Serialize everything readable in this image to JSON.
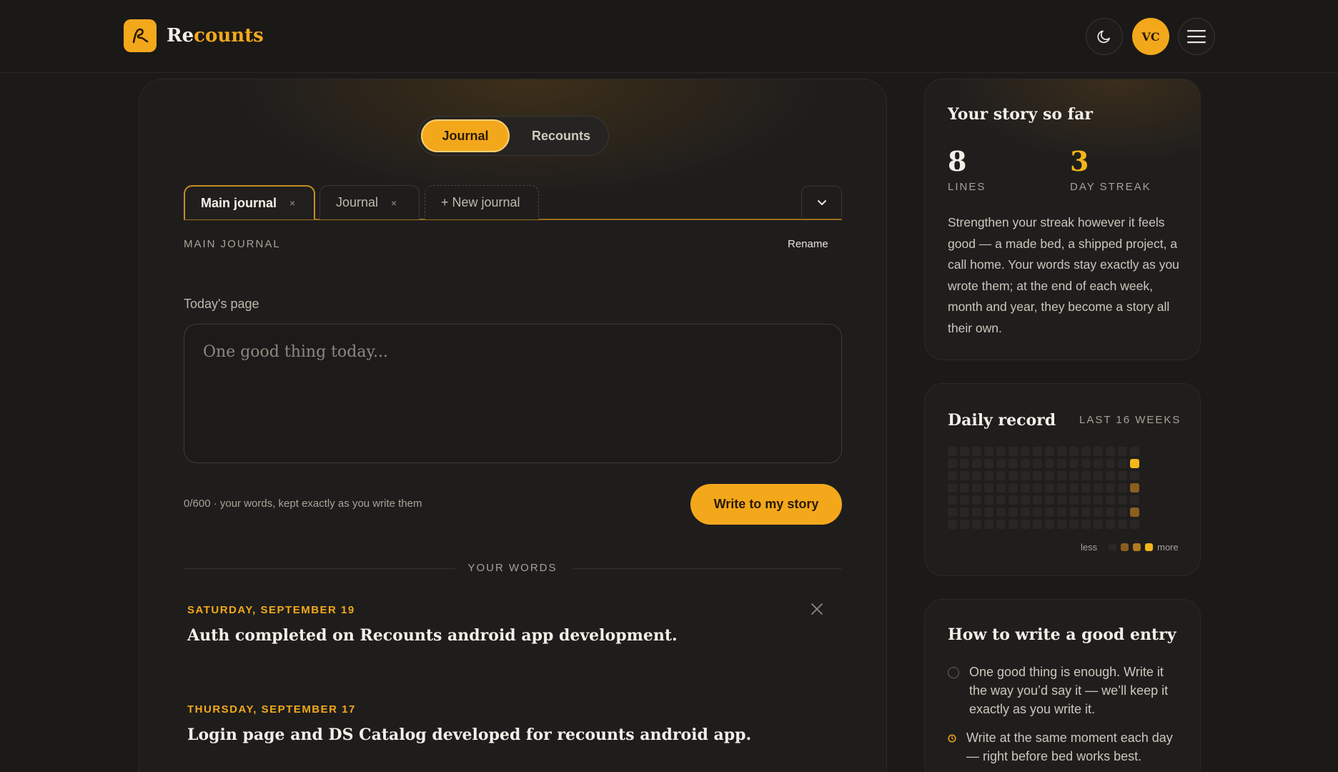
{
  "header": {
    "brand_prefix": "Re",
    "brand_suffix": "counts",
    "avatar_initials": "VC",
    "theme_icon": "moon-icon",
    "menu_icon": "hamburger-icon"
  },
  "mode_toggle": {
    "journal_label": "Journal",
    "recounts_label": "Recounts"
  },
  "tabs": [
    {
      "label": "Main journal",
      "close": "×"
    },
    {
      "label": "Journal",
      "close": "×"
    },
    {
      "label": "+ New journal"
    }
  ],
  "journal": {
    "section_label": "MAIN JOURNAL",
    "rename_label": "Rename",
    "today_label": "Today's page",
    "placeholder": "One good thing today...",
    "counter": "0/600 · your words, kept exactly as you write them",
    "write_button": "Write to my story",
    "divider_label": "YOUR WORDS"
  },
  "entries": [
    {
      "date": "SATURDAY, SEPTEMBER 19",
      "text": "Auth completed on Recounts android app development."
    },
    {
      "date": "THURSDAY, SEPTEMBER 17",
      "text": "Login page and DS Catalog developed for recounts android app."
    }
  ],
  "story": {
    "title": "Your story so far",
    "lines_value": "8",
    "lines_label": "LINES",
    "streak_value": "3",
    "streak_label": "DAY STREAK",
    "text": "Strengthen your streak however it feels good — a made bed, a shipped project, a call home. Your words stay exactly as you wrote them; at the end of each week, month and year, they become a story all their own."
  },
  "record": {
    "title": "Daily record",
    "subtitle": "LAST 16 WEEKS",
    "legend_less": "less",
    "legend_more": "more",
    "weeks": 16,
    "days": 7,
    "active_cells": [
      {
        "week": 15,
        "day": 1,
        "level": 3
      },
      {
        "week": 15,
        "day": 3,
        "level": 2
      },
      {
        "week": 15,
        "day": 5,
        "level": 2
      }
    ]
  },
  "howto": {
    "title": "How to write a good entry",
    "items": [
      "One good thing is enough. Write it the way you’d say it — we’ll keep it exactly as you write it.",
      "Write at the same moment each day — right before bed works best."
    ]
  },
  "colors": {
    "accent": "#f3a81b",
    "level1": "#5a3f1c",
    "level2": "#8a5e1e",
    "level3": "#f3b51b"
  }
}
